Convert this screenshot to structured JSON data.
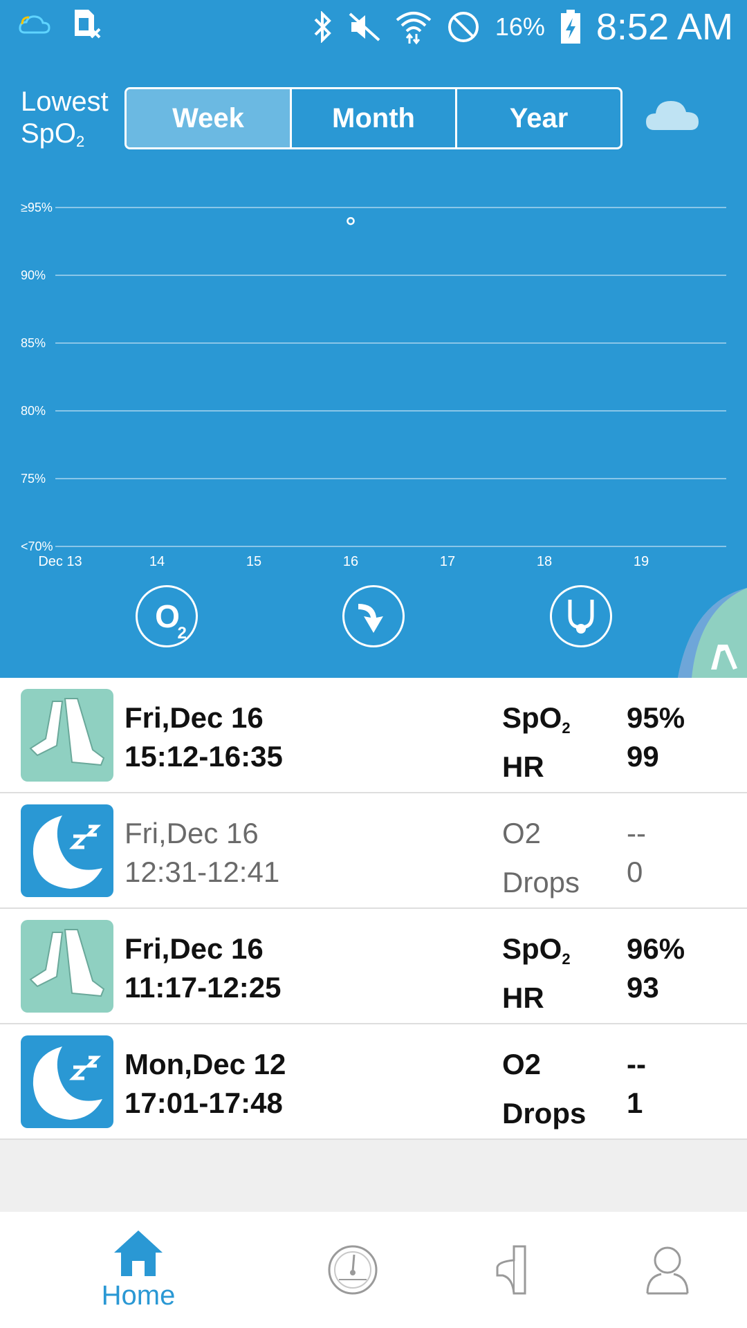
{
  "status_bar": {
    "battery_percent": "16%",
    "time": "8:52 AM",
    "icons": [
      "weather-icon",
      "sim-blocked-icon",
      "bluetooth-icon",
      "mute-icon",
      "wifi-icon",
      "do-not-disturb-icon",
      "battery-charging-icon"
    ]
  },
  "header": {
    "title_line1": "Lowest",
    "title_line2": "SpO",
    "title_sub": "2",
    "tabs": [
      "Week",
      "Month",
      "Year"
    ],
    "active_tab": "Week",
    "cloud_icon": "cloud-sync-icon"
  },
  "chart_data": {
    "type": "scatter",
    "title": "",
    "xlabel": "",
    "ylabel": "",
    "y_tick_labels": [
      "≥95%",
      "90%",
      "85%",
      "80%",
      "75%",
      "<70%"
    ],
    "ylim": [
      70,
      95
    ],
    "x_tick_labels": [
      "Dec 13",
      "14",
      "15",
      "16",
      "17",
      "18",
      "19"
    ],
    "series": [
      {
        "points": [
          {
            "x": "16",
            "y": 94
          }
        ]
      }
    ],
    "grid": true
  },
  "round_buttons": [
    "o2-icon",
    "drop-icon",
    "stethoscope-icon"
  ],
  "records": [
    {
      "type": "walk",
      "icon": "walk-icon",
      "day": "Fri,Dec 16",
      "time": "15:12-16:35",
      "k1": "SpO",
      "k1_sub": "2",
      "v1": "95%",
      "k2": "HR",
      "v2": "99",
      "dim": false
    },
    {
      "type": "sleep",
      "icon": "sleep-icon",
      "day": "Fri,Dec 16",
      "time": "12:31-12:41",
      "k1": "O2",
      "k1_sub": "",
      "v1": "--",
      "k2": "Drops",
      "v2": "0",
      "dim": true
    },
    {
      "type": "walk",
      "icon": "walk-icon",
      "day": "Fri,Dec 16",
      "time": "11:17-12:25",
      "k1": "SpO",
      "k1_sub": "2",
      "v1": "96%",
      "k2": "HR",
      "v2": "93",
      "dim": false
    },
    {
      "type": "sleep",
      "icon": "sleep-icon",
      "day": "Mon,Dec 12",
      "time": "17:01-17:48",
      "k1": "O2",
      "k1_sub": "",
      "v1": "--",
      "k2": "Drops",
      "v2": "1",
      "dim": false
    }
  ],
  "nav": {
    "items": [
      {
        "icon": "home-icon",
        "label": "Home",
        "active": true
      },
      {
        "icon": "gauge-icon",
        "label": "",
        "active": false
      },
      {
        "icon": "device-icon",
        "label": "",
        "active": false
      },
      {
        "icon": "profile-icon",
        "label": "",
        "active": false
      }
    ]
  },
  "colors": {
    "primary_blue": "#2a98d4",
    "active_tab": "#6bb9e2",
    "mint": "#8fd0c1"
  }
}
